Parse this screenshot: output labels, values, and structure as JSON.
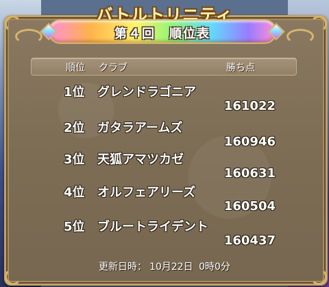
{
  "title": "バトルトリニティ",
  "subtitle": "第４回　順位表",
  "header": {
    "rank": "順位",
    "club": "クラブ",
    "points": "勝ち点"
  },
  "rows": [
    {
      "rank": "1位",
      "club": "グレンドラゴニア",
      "points": "161022"
    },
    {
      "rank": "2位",
      "club": "ガタラアームズ",
      "points": "160946"
    },
    {
      "rank": "3位",
      "club": "天狐アマツカゼ",
      "points": "160631"
    },
    {
      "rank": "4位",
      "club": "オルフェアリーズ",
      "points": "160504"
    },
    {
      "rank": "5位",
      "club": "ブルートライデント",
      "points": "160437"
    }
  ],
  "footer": {
    "label": "更新日時：",
    "date": "10月22日",
    "time": "0時0分"
  },
  "colors": {
    "panel": "#7d6d55",
    "border": "#c2a165",
    "title": "#fff3b0"
  }
}
